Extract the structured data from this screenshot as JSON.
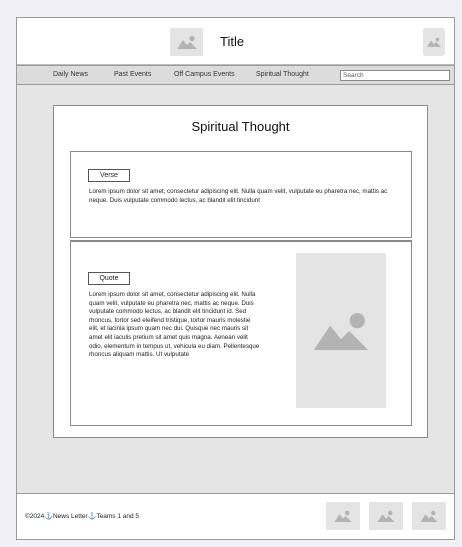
{
  "header": {
    "title": "Title",
    "logo_icon": "image-placeholder-icon",
    "corner_icon": "image-placeholder-icon"
  },
  "nav": {
    "items": [
      {
        "label": "Daily News"
      },
      {
        "label": "Past Events"
      },
      {
        "label": "Off Campus Events"
      },
      {
        "label": "Spiritual Thought"
      }
    ],
    "search": {
      "placeholder": "Search",
      "value": ""
    }
  },
  "main": {
    "page_title": "Spiritual Thought",
    "verse": {
      "tag": "Verse",
      "text": "Lorem ipsum dolor sit amet, consectetur adipiscing elit. Nulla quam velit, vulputate eu pharetra nec, mattis ac neque. Duis vulputate commodo lectus, ac blandit elit tincidunt"
    },
    "quote": {
      "tag": "Quote",
      "text": "Lorem ipsum dolor sit amet, consectetur adipiscing elit. Nulla quam velit, vulputate eu pharetra nec, mattis ac neque. Duis vulputate commodo lectus, ac blandit elit tincidunt id. Sed rhoncus, tortor sed eleifend tristique, tortor mauris molestie elit, et lacinia ipsum quam nec dui. Quisque nec mauris sit amet elit iaculis pretium sit amet quis magna. Aenean velit odio, elementum in tempus ut, vehicula eu diam. Pellentesque rhoncus aliquam mattis. Ut vulputate",
      "image_icon": "image-placeholder-icon"
    }
  },
  "footer": {
    "copyright": "©2024",
    "newsletter": "News Letter",
    "teams": "Teams 1 and 5",
    "anchor_icon": "anchor-icon",
    "social_icons": [
      "image-placeholder-icon",
      "image-placeholder-icon",
      "image-placeholder-icon"
    ]
  },
  "colors": {
    "frame_bg": "#e5e5e5",
    "placeholder_bg": "#e4e4e4",
    "placeholder_fg": "#b3b3b3",
    "link_anchor": "#3a6fb0"
  }
}
